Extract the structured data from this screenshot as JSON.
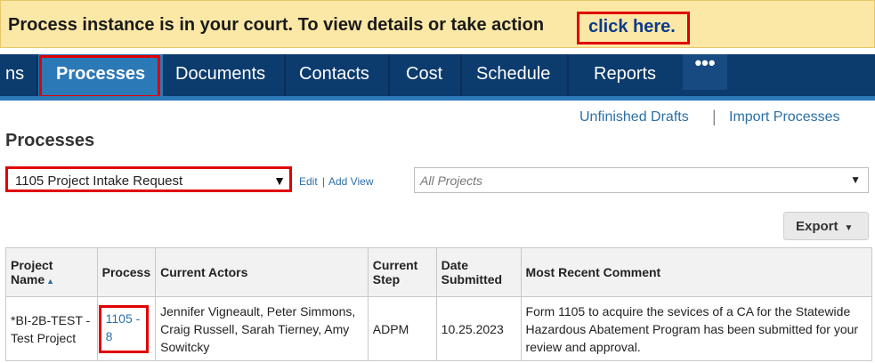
{
  "notice": {
    "text": "Process instance is in your court. To view details or take action",
    "link": "click here."
  },
  "nav": {
    "tabs": [
      {
        "label": "ns"
      },
      {
        "label": "Processes",
        "active": true
      },
      {
        "label": "Documents"
      },
      {
        "label": "Contacts"
      },
      {
        "label": "Cost"
      },
      {
        "label": "Schedule"
      },
      {
        "label": "Reports"
      }
    ],
    "more": "•••"
  },
  "top_links": {
    "unfinished": "Unfinished Drafts",
    "separator": "|",
    "import": "Import Processes"
  },
  "page_title": "Processes",
  "view_select": {
    "value": "1105 Project Intake Request",
    "edit": "Edit",
    "separator": "|",
    "add_view": "Add View"
  },
  "project_select": {
    "placeholder": "All Projects"
  },
  "export": {
    "label": "Export"
  },
  "table": {
    "headers": {
      "project": "Project Name",
      "process": "Process",
      "actors": "Current Actors",
      "step": "Current Step",
      "date": "Date Submitted",
      "comment": "Most Recent Comment"
    },
    "rows": [
      {
        "project": "*BI-2B-TEST - Test Project",
        "process": "1105 - 8",
        "actors": "Jennifer Vigneault, Peter Simmons, Craig Russell, Sarah Tierney, Amy Sowitcky",
        "step": "ADPM",
        "date": "10.25.2023",
        "comment": "Form 1105 to acquire the sevices of a CA for the Statewide Hazardous Abatement Program has been submitted for your review and approval."
      }
    ]
  },
  "colors": {
    "notice_bg": "#fce8a6",
    "nav_bg": "#0c3b6e",
    "nav_active": "#2c79b8",
    "link": "#2a6fa8",
    "highlight": "#e00000"
  }
}
